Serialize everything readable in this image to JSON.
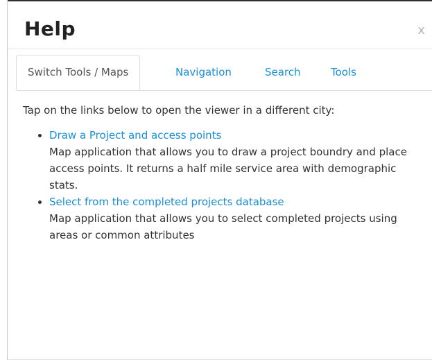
{
  "dialog": {
    "title": "Help",
    "close_label": "x"
  },
  "tabs": [
    {
      "label": "Switch Tools / Maps",
      "active": true
    },
    {
      "label": "Navigation",
      "active": false
    },
    {
      "label": "Search",
      "active": false
    },
    {
      "label": "Tools",
      "active": false
    }
  ],
  "content": {
    "intro": "Tap on the links below to open the viewer in a different city:",
    "items": [
      {
        "link": "Draw a Project and access points",
        "description": "Map application that allows you to draw a project boundry and place access points. It returns a half mile service area with demographic stats."
      },
      {
        "link": "Select from the completed projects database",
        "description": "Map application that allows you to select completed projects using areas or common attributes"
      }
    ]
  },
  "colors": {
    "link": "#1a8fd6",
    "text": "#333333",
    "title": "#222222",
    "close": "#b5b5b5",
    "border": "#dddddd"
  }
}
